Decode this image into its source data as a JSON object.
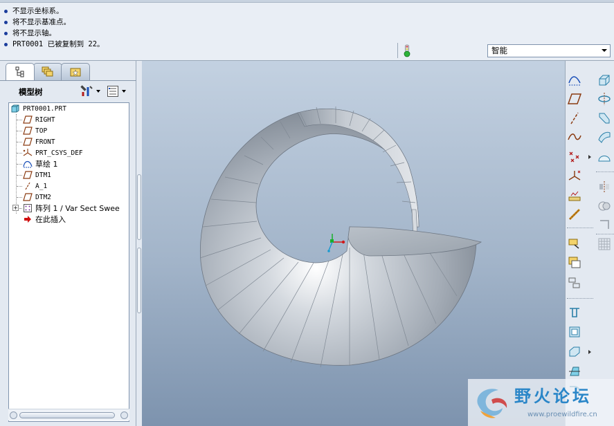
{
  "messages": [
    "不显示坐标系。",
    "将不显示基准点。",
    "将不显示轴。",
    "PRT0001 已被复制到 22。"
  ],
  "filter": {
    "selected": "智能"
  },
  "nav_tabs": [
    {
      "icon": "model-tree-icon",
      "active": true
    },
    {
      "icon": "folder-browser-icon",
      "active": false
    },
    {
      "icon": "favorites-icon",
      "active": false
    }
  ],
  "model_tree": {
    "title": "模型树",
    "items": [
      {
        "label": "PRT0001.PRT",
        "icon": "part-icon"
      },
      {
        "label": "RIGHT",
        "icon": "datum-plane-icon"
      },
      {
        "label": "TOP",
        "icon": "datum-plane-icon"
      },
      {
        "label": "FRONT",
        "icon": "datum-plane-icon"
      },
      {
        "label": "PRT_CSYS_DEF",
        "icon": "csys-icon"
      },
      {
        "label": "草绘 1",
        "icon": "sketch-icon"
      },
      {
        "label": "DTM1",
        "icon": "datum-plane-icon"
      },
      {
        "label": "A_1",
        "icon": "axis-icon"
      },
      {
        "label": "DTM2",
        "icon": "datum-plane-icon"
      },
      {
        "label": "阵列 1 / Var Sect Swee",
        "icon": "pattern-icon"
      },
      {
        "label": "在此插入",
        "icon": "insert-here-icon"
      }
    ]
  },
  "watermark": {
    "title": "野火论坛",
    "url": "www.proewildfire.cn"
  },
  "colors": {
    "message_bullet": "#1a3c9c",
    "graphics_top": "#c3d1e1",
    "graphics_bottom": "#7d93ae",
    "model_surface": "#a8b0b9",
    "insert_arrow": "#d01010",
    "watermark_text": "#2a86c8"
  },
  "right_toolbar": {
    "left_column": [
      "datum-curve-sketch-icon",
      "datum-plane-icon",
      "datum-axis-icon",
      "datum-curve-icon",
      "datum-point-icon",
      "csys-icon",
      "analysis-icon",
      "reference-icon",
      "insert-feature-icon",
      "copy-feature-icon",
      "mirror-feature-icon",
      "hole-icon",
      "shell-icon",
      "rib-icon",
      "draft-icon",
      "round-icon"
    ],
    "right_column": [
      "extrude-icon",
      "revolve-icon",
      "sweep-icon",
      "blend-icon",
      "boundary-icon",
      "mirror-icon",
      "merge-icon",
      "trim-icon",
      "pattern-grid-icon"
    ]
  }
}
